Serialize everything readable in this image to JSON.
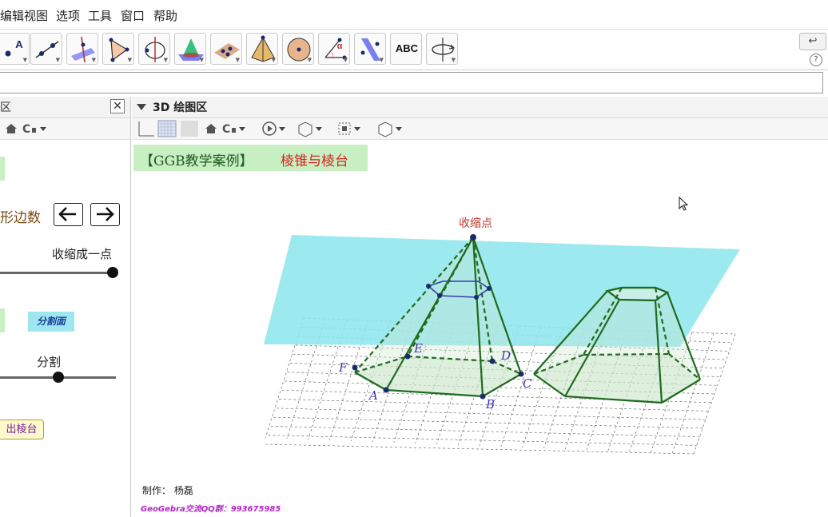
{
  "menu": [
    "编辑",
    "视图",
    "选项",
    "工具",
    "窗口",
    "帮助"
  ],
  "toolbar": {
    "tools": [
      {
        "icon": "point-icon",
        "label": "A"
      },
      {
        "icon": "line-icon"
      },
      {
        "icon": "perpendicular-line-icon"
      },
      {
        "icon": "polygon-icon"
      },
      {
        "icon": "circle-axis-icon"
      },
      {
        "icon": "intersect-surfaces-icon"
      },
      {
        "icon": "plane-through-points-icon"
      },
      {
        "icon": "pyramid-icon"
      },
      {
        "icon": "sphere-icon"
      },
      {
        "icon": "angle-icon",
        "label": "α"
      },
      {
        "icon": "reflect-plane-icon"
      },
      {
        "icon": "text-icon",
        "label": "ABC"
      },
      {
        "icon": "rotate-view-icon"
      }
    ],
    "undo_icon": "↩",
    "help_icon": "?"
  },
  "left_panel": {
    "title": "区",
    "close": "✕",
    "polygon_sides_label": "形边数",
    "prev_icon": "arrow-left-icon",
    "next_icon": "arrow-right-icon",
    "shrink_label": "收缩成一点",
    "shrink_value": 1.0,
    "split_plane_label": "分割面",
    "split_label": "分割",
    "split_value": 0.5,
    "frustum_button": "出棱台"
  },
  "view": {
    "title": "3D 绘图区",
    "banner_left": "【GGB教学案例】",
    "banner_right": "棱锥与棱台",
    "apex_label": "收缩点",
    "vertex_labels": [
      "A",
      "B",
      "C",
      "D",
      "E",
      "F"
    ],
    "author": "制作：   杨磊",
    "qq": "GeoGebra交流QQ群：993675985"
  },
  "colors": {
    "plane": "#8fe6ee",
    "edge": "#1f6b1f",
    "face": "#cde8cd",
    "vertex": "#1a2a6b",
    "section": "#3a3aaa",
    "banner_bg": "#c8efc2"
  }
}
